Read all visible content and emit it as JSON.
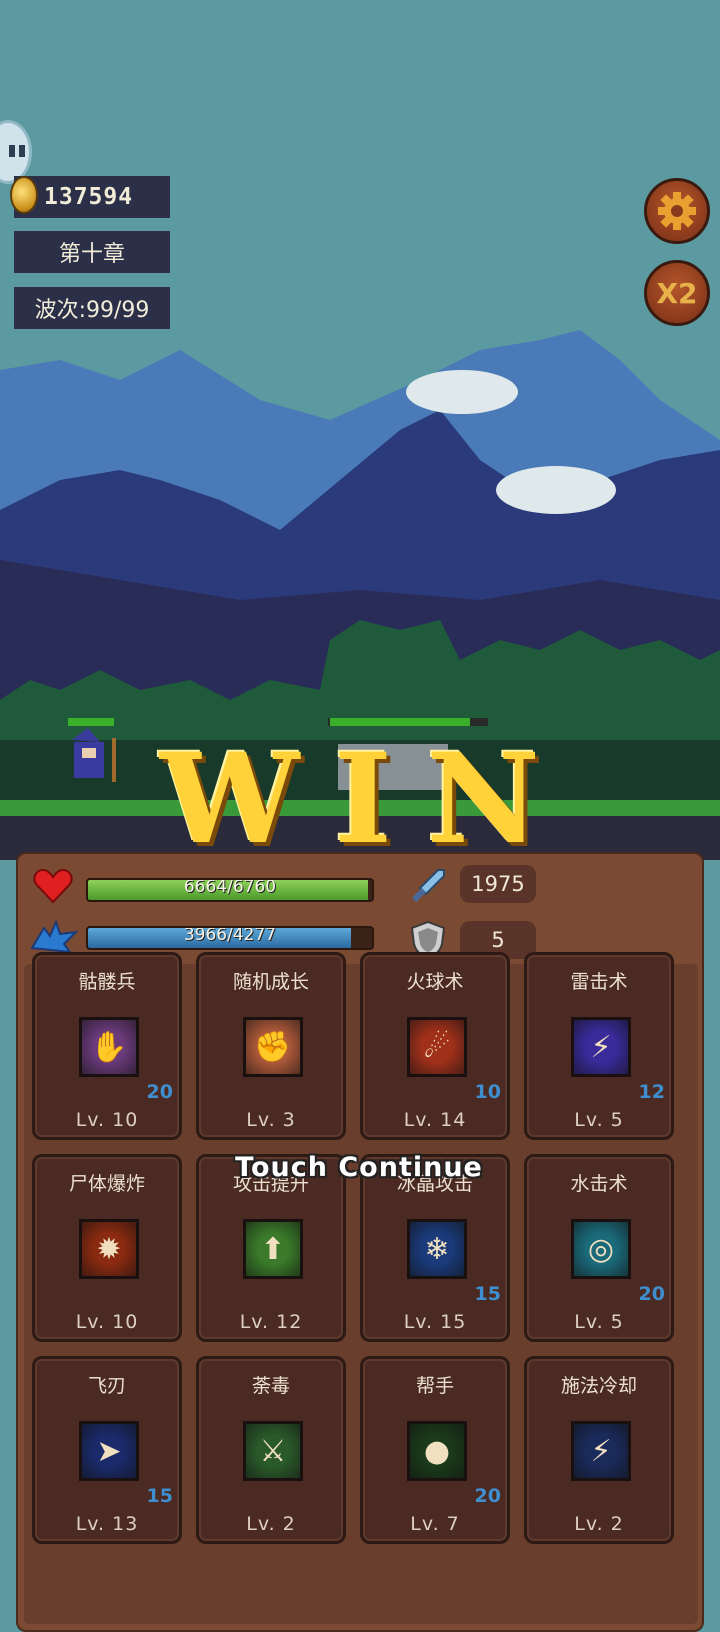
{
  "hud": {
    "coins": "137594",
    "chapter": "第十章",
    "wave": "波次:99/99",
    "speed_label": "X2"
  },
  "win": {
    "letters": [
      "W",
      "I",
      "N"
    ]
  },
  "stats": {
    "hp_text": "6664/6760",
    "hp_current": 6664,
    "hp_max": 6760,
    "mp_text": "3966/4277",
    "mp_current": 3966,
    "mp_max": 4277,
    "attack": "1975",
    "defense": "5"
  },
  "touch_continue": "Touch Continue",
  "skills": [
    {
      "name": "骷髅兵",
      "count": "20",
      "level": "Lv. 10",
      "icon": "skeleton-hand-icon",
      "color": "#6a3a7a",
      "glyph": "✋"
    },
    {
      "name": "随机成长",
      "count": "",
      "level": "Lv. 3",
      "icon": "fist-icon",
      "color": "#b05a3a",
      "glyph": "✊"
    },
    {
      "name": "火球术",
      "count": "10",
      "level": "Lv. 14",
      "icon": "fireball-icon",
      "color": "#a0301a",
      "glyph": "☄"
    },
    {
      "name": "雷击术",
      "count": "12",
      "level": "Lv. 5",
      "icon": "thunder-strike-icon",
      "color": "#3a2a9a",
      "glyph": "⚡"
    },
    {
      "name": "尸体爆炸",
      "count": "",
      "level": "Lv. 10",
      "icon": "corpse-explosion-icon",
      "color": "#8a2a10",
      "glyph": "✹"
    },
    {
      "name": "攻击提升",
      "count": "",
      "level": "Lv. 12",
      "icon": "attack-up-icon",
      "color": "#3a7a2a",
      "glyph": "⬆"
    },
    {
      "name": "冰晶攻击",
      "count": "15",
      "level": "Lv. 15",
      "icon": "ice-crystal-icon",
      "color": "#1a3a7a",
      "glyph": "❄"
    },
    {
      "name": "水击术",
      "count": "20",
      "level": "Lv. 5",
      "icon": "water-wave-icon",
      "color": "#1a6a7a",
      "glyph": "◎"
    },
    {
      "name": "飞刃",
      "count": "15",
      "level": "Lv. 13",
      "icon": "flying-blade-icon",
      "color": "#1a2a6a",
      "glyph": "➤"
    },
    {
      "name": "荼毒",
      "count": "",
      "level": "Lv. 2",
      "icon": "poison-icon",
      "color": "#2a5a2a",
      "glyph": "⚔"
    },
    {
      "name": "帮手",
      "count": "20",
      "level": "Lv. 7",
      "icon": "slime-helper-icon",
      "color": "#1a3a1a",
      "glyph": "●"
    },
    {
      "name": "施法冷却",
      "count": "",
      "level": "Lv. 2",
      "icon": "cooldown-lightning-icon",
      "color": "#1a2a5a",
      "glyph": "⚡"
    }
  ]
}
